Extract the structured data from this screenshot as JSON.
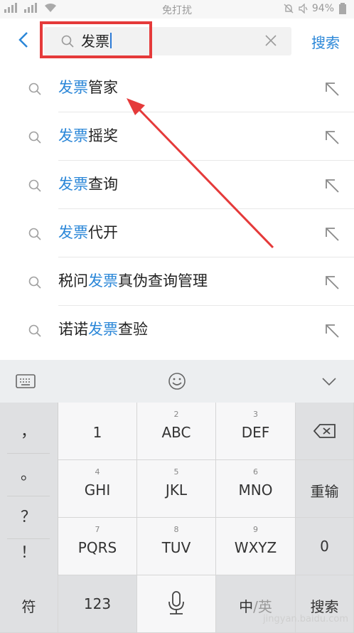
{
  "status_bar": {
    "left_icons": [
      "signal-1-icon",
      "signal-2-icon",
      "wifi-icon"
    ],
    "center_text": "免打扰",
    "right_icons": [
      "alarm-icon",
      "no-sound-icon"
    ],
    "battery": "94%"
  },
  "search_bar": {
    "back_icon": "chevron-left-icon",
    "query": "发票",
    "clear_icon": "close-icon",
    "submit_label": "搜索"
  },
  "suggestions": [
    {
      "prefix": "",
      "highlight": "发票",
      "suffix": "管家"
    },
    {
      "prefix": "",
      "highlight": "发票",
      "suffix": "摇奖"
    },
    {
      "prefix": "",
      "highlight": "发票",
      "suffix": "查询"
    },
    {
      "prefix": "",
      "highlight": "发票",
      "suffix": "代开"
    },
    {
      "prefix": "税问",
      "highlight": "发票",
      "suffix": "真伪查询管理"
    },
    {
      "prefix": "诺诺",
      "highlight": "发票",
      "suffix": "查验"
    }
  ],
  "keyboard": {
    "toolbar_icons": [
      "keyboard-icon",
      "emoji-icon",
      "chevron-down-icon"
    ],
    "punctuation": [
      "，",
      "。",
      "？",
      "！"
    ],
    "rows": [
      [
        {
          "num": "",
          "label": "1"
        },
        {
          "num": "2",
          "label": "ABC"
        },
        {
          "num": "3",
          "label": "DEF"
        }
      ],
      [
        {
          "num": "4",
          "label": "GHI"
        },
        {
          "num": "5",
          "label": "JKL"
        },
        {
          "num": "6",
          "label": "MNO"
        }
      ],
      [
        {
          "num": "7",
          "label": "PQRS"
        },
        {
          "num": "8",
          "label": "TUV"
        },
        {
          "num": "9",
          "label": "WXYZ"
        }
      ]
    ],
    "right_keys": [
      "backspace-icon",
      "重输",
      "0"
    ],
    "bottom": {
      "symbols": "符",
      "numbers": "123",
      "mic_icon": "microphone-icon",
      "lang_active": "中",
      "lang_sep": "/",
      "lang_other": "英",
      "search": "搜索"
    }
  },
  "watermark": "jingyan.baidu.com",
  "colors": {
    "accent": "#2b87d8",
    "annotation": "#e53a3a"
  }
}
